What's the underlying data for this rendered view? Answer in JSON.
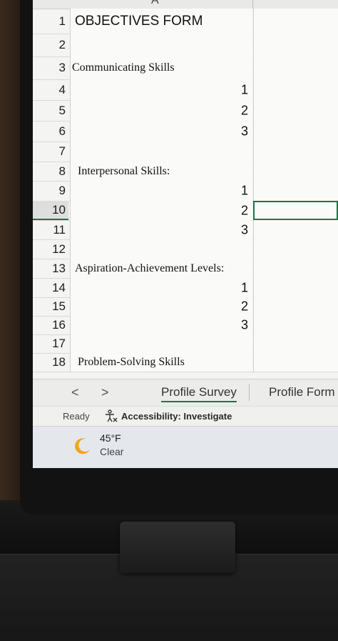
{
  "spreadsheet": {
    "column_header": "A",
    "rows": [
      {
        "num": "1",
        "a": "OBJECTIVES FORM",
        "b": ""
      },
      {
        "num": "2",
        "a": "",
        "b": ""
      },
      {
        "num": "3",
        "a": "Communicating Skills",
        "b": ""
      },
      {
        "num": "4",
        "a": "",
        "b": "1"
      },
      {
        "num": "5",
        "a": "",
        "b": "2"
      },
      {
        "num": "6",
        "a": "",
        "b": "3"
      },
      {
        "num": "7",
        "a": "",
        "b": ""
      },
      {
        "num": "8",
        "a": "Interpersonal Skills:",
        "b": ""
      },
      {
        "num": "9",
        "a": "",
        "b": "1"
      },
      {
        "num": "10",
        "a": "",
        "b": "2"
      },
      {
        "num": "11",
        "a": "",
        "b": "3"
      },
      {
        "num": "12",
        "a": "",
        "b": ""
      },
      {
        "num": "13",
        "a": "Aspiration-Achievement Levels:",
        "b": ""
      },
      {
        "num": "14",
        "a": "",
        "b": "1"
      },
      {
        "num": "15",
        "a": "",
        "b": "2"
      },
      {
        "num": "16",
        "a": "",
        "b": "3"
      },
      {
        "num": "17",
        "a": "",
        "b": ""
      },
      {
        "num": "18",
        "a": "Problem-Solving Skills",
        "b": ""
      }
    ]
  },
  "sheet_tabs": {
    "prev": "<",
    "next": ">",
    "tabs": [
      "Profile Survey",
      "Profile Form"
    ]
  },
  "status_bar": {
    "ready": "Ready",
    "accessibility": "Accessibility: Investigate",
    "accessibility_icon": "accessibility-icon"
  },
  "taskbar": {
    "weather_icon": "moon-icon",
    "temperature": "45°F",
    "condition": "Clear"
  }
}
